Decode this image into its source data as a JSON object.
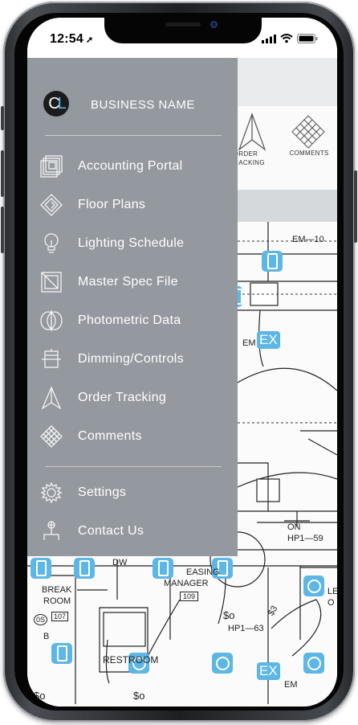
{
  "status_bar": {
    "time": "12:54"
  },
  "menu": {
    "logo_text": "CL",
    "business_name": "BUSINESS NAME",
    "items": [
      {
        "label": "Accounting Portal",
        "icon": "layered-squares-icon"
      },
      {
        "label": "Floor Plans",
        "icon": "diamond-layers-icon"
      },
      {
        "label": "Lighting Schedule",
        "icon": "light-bulb-icon"
      },
      {
        "label": "Master Spec File",
        "icon": "spec-box-icon"
      },
      {
        "label": "Photometric Data",
        "icon": "photometric-circles-icon"
      },
      {
        "label": "Dimming/Controls",
        "icon": "dimmer-icon"
      },
      {
        "label": "Order Tracking",
        "icon": "paper-plane-icon"
      },
      {
        "label": "Comments",
        "icon": "crosshatch-icon"
      }
    ],
    "footer_items": [
      {
        "label": "Settings",
        "icon": "gear-icon"
      },
      {
        "label": "Contact Us",
        "icon": "contact-person-icon"
      }
    ]
  },
  "background_app": {
    "tabs": [
      {
        "label": "ORDER\nTRACKING"
      },
      {
        "label": "COMMENTS"
      }
    ],
    "plan_labels": {
      "em_top": "EM—10",
      "em_mid": "EM",
      "ex1": "EX",
      "ex2": "EX",
      "on": "ON",
      "hp1_59": "HP1—59",
      "break": "BREAK",
      "room": "ROOM",
      "room_num": "107",
      "os": "0S",
      "b": "B",
      "leasing": "EASING",
      "manager": "MANAGER",
      "mgr_num": "109",
      "dw": "DW",
      "hp1_63": "HP1—63",
      "s3": "$3",
      "restroom": "RESTROOM",
      "em_low": "EM",
      "le": "LE",
      "o": "O",
      "so1": "$o",
      "so2": "$o",
      "so3": "$o"
    }
  }
}
